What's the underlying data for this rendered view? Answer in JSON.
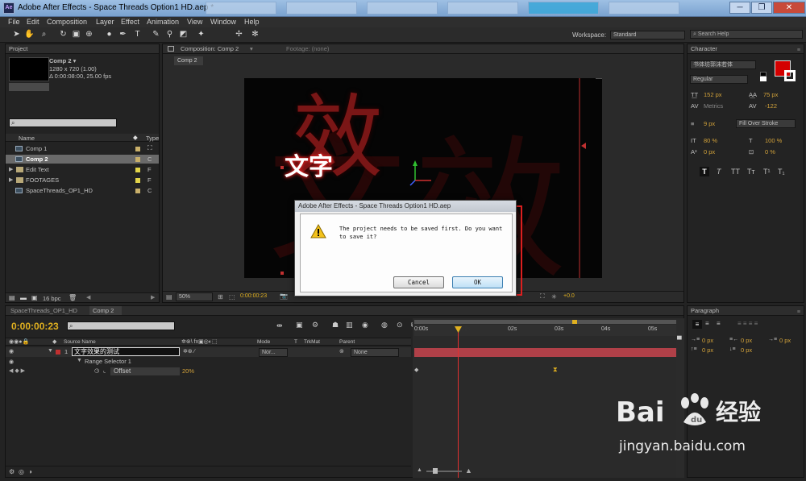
{
  "window": {
    "title": "Adobe After Effects - Space Threads Option1 HD.aep *",
    "controls": {
      "minimize": "─",
      "maximize": "❐",
      "close": "✕"
    }
  },
  "menu": [
    "File",
    "Edit",
    "Composition",
    "Layer",
    "Effect",
    "Animation",
    "View",
    "Window",
    "Help"
  ],
  "toolbar": {
    "workspace_label": "Workspace:",
    "workspace_value": "Standard",
    "search_placeholder": "Search Help"
  },
  "project_panel": {
    "tab": "Project",
    "comp_name": "Comp 2 ▾",
    "comp_size": "1280 x 720 (1.00)",
    "comp_duration": "Δ 0:00:08:00, 25.00 fps",
    "col_name": "Name",
    "col_type": "Type",
    "items": [
      {
        "name": "Comp 1",
        "kind": "comp",
        "type": "C"
      },
      {
        "name": "Comp 2",
        "kind": "comp",
        "type": "C"
      },
      {
        "name": "Edit Text",
        "kind": "folder",
        "type": "F"
      },
      {
        "name": "FOOTAGES",
        "kind": "folder",
        "type": "F"
      },
      {
        "name": "SpaceThreads_OP1_HD",
        "kind": "comp",
        "type": "C"
      }
    ],
    "bpc": "16 bpc"
  },
  "comp_panel": {
    "tab": "Composition: Comp 2",
    "footage_tab": "Footage: (none)",
    "subtab": "Comp 2",
    "big_char": "效",
    "text_layer": "文字",
    "zoom": "50%",
    "timecode": "0:00:00:23",
    "exposure": "+0.0"
  },
  "character_panel": {
    "tab": "Character",
    "font": "书体坊郭沫若体",
    "style": "Regular",
    "font_size": "152 px",
    "leading": "75 px",
    "kerning": "Metrics",
    "tracking": "-122",
    "stroke_width": "9 px",
    "stroke_mode": "Fill Over Stroke",
    "vscale": "80 %",
    "hscale": "100 %",
    "baseline": "0 px",
    "tsume": "0 %",
    "style_buttons": [
      "T",
      "T",
      "TT",
      "Tт",
      "T¹",
      "T₁"
    ],
    "fill_color": "#d40000"
  },
  "paragraph_panel": {
    "tab": "Paragraph",
    "values": [
      "0 px",
      "0 px",
      "0 px",
      "0 px",
      "0 px"
    ]
  },
  "timeline": {
    "tabs": [
      "SpaceThreads_OP1_HD",
      "Comp 2"
    ],
    "timecode": "0:00:00:23",
    "col_source": "Source Name",
    "col_mode": "Mode",
    "col_t": "T",
    "col_trkmat": "TrkMat",
    "col_parent": "Parent",
    "layer_num": "1",
    "layer_name": "文字效果的测试",
    "layer_mode": "Nor...",
    "layer_parent": "None",
    "range_selector": "Range Selector 1",
    "offset_label": "Offset",
    "offset_value": "20%",
    "ruler": [
      "0:00s",
      "01s",
      "02s",
      "03s",
      "04s",
      "05s"
    ]
  },
  "dialog": {
    "title": "Adobe After Effects - Space Threads Option1 HD.aep",
    "message_line1": "The project needs to be saved first. Do you want",
    "message_line2": "to save it?",
    "cancel": "Cancel",
    "ok": "OK"
  },
  "watermark": {
    "brand": "Bai",
    "brand2": "经验",
    "url": "jingyan.baidu.com"
  },
  "colors": {
    "accent_red": "#e02020",
    "timecode_yellow": "#e0b020",
    "layer_bar": "#b04048",
    "cti": "#e03030"
  }
}
